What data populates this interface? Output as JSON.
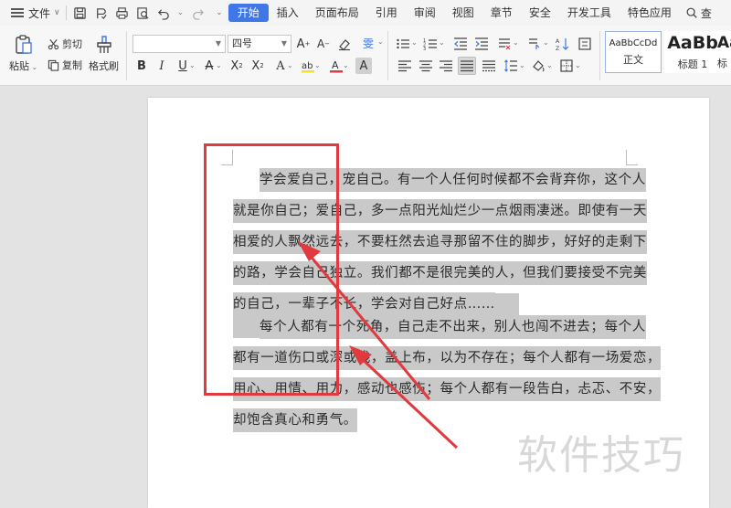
{
  "menubar": {
    "file_label": "文件",
    "tabs": [
      "开始",
      "插入",
      "页面布局",
      "引用",
      "审阅",
      "视图",
      "章节",
      "安全",
      "开发工具",
      "特色应用"
    ],
    "active_tab": "开始",
    "search_label": "查",
    "accent_color": "#3f76e8"
  },
  "ribbon": {
    "paste_label": "粘贴",
    "cut_label": "剪切",
    "copy_label": "复制",
    "format_painter_label": "格式刷",
    "font_name": "",
    "font_size": "四号",
    "styles": [
      {
        "preview": "AaBbCcDd",
        "name": "正文"
      },
      {
        "preview": "AaBb",
        "name": "标题 1"
      },
      {
        "preview": "Aa",
        "name": "标"
      }
    ]
  },
  "document": {
    "paragraph1": [
      "学会爱自己，宠自己。有一个人任何时候都不会背弃你，这个人",
      "就是你自己；爱自己，多一点阳光灿烂少一点烟雨凄迷。即使有一天",
      "相爱的人飘然远去，不要枉然去追寻那留不住的脚步，好好的走剩下",
      "的路，学会自己独立。我们都不是很完美的人，但我们要接受不完美",
      "的自己，一辈子不长，学会对自己好点……"
    ],
    "paragraph2": [
      "每个人都有一个死角，自己走不出来，别人也闯不进去；每个人",
      "都有一道伤口或深或浅，盖上布，以为不存在；每个人都有一场爱恋，",
      "用心、用情、用力，感动也感伤；每个人都有一段告白，忐忑、不安，",
      "却饱含真心和勇气。"
    ],
    "selection_color": "#c9c9c9"
  },
  "annotation": {
    "box_color": "#e03a3e"
  },
  "watermark": "软件技巧"
}
